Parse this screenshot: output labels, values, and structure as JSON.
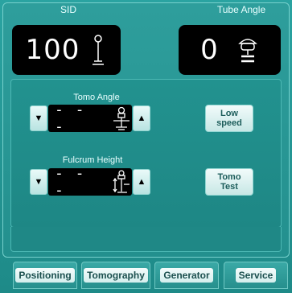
{
  "header": {
    "sid_label": "SID",
    "tube_angle_label": "Tube Angle"
  },
  "sid": {
    "value": "100",
    "icon": "sid-distance-icon"
  },
  "tube_angle": {
    "value": "0",
    "icon": "tube-icon"
  },
  "tomo_angle": {
    "label": "Tomo Angle",
    "value": "- - -",
    "decrease_glyph": "▼",
    "increase_glyph": "▲",
    "icon": "tomo-angle-icon"
  },
  "fulcrum_height": {
    "label": "Fulcrum Height",
    "value": "- - -",
    "decrease_glyph": "▼",
    "increase_glyph": "▲",
    "icon": "fulcrum-height-icon"
  },
  "buttons": {
    "low_speed": "Low\nspeed",
    "tomo_test": "Tomo\nTest"
  },
  "tabs": [
    {
      "label": "Positioning"
    },
    {
      "label": "Tomography"
    },
    {
      "label": "Generator"
    },
    {
      "label": "Service"
    }
  ],
  "colors": {
    "background": "#2aa3a1",
    "panel": "#22928f",
    "display": "#000000",
    "button_text": "#1d5d5b"
  }
}
